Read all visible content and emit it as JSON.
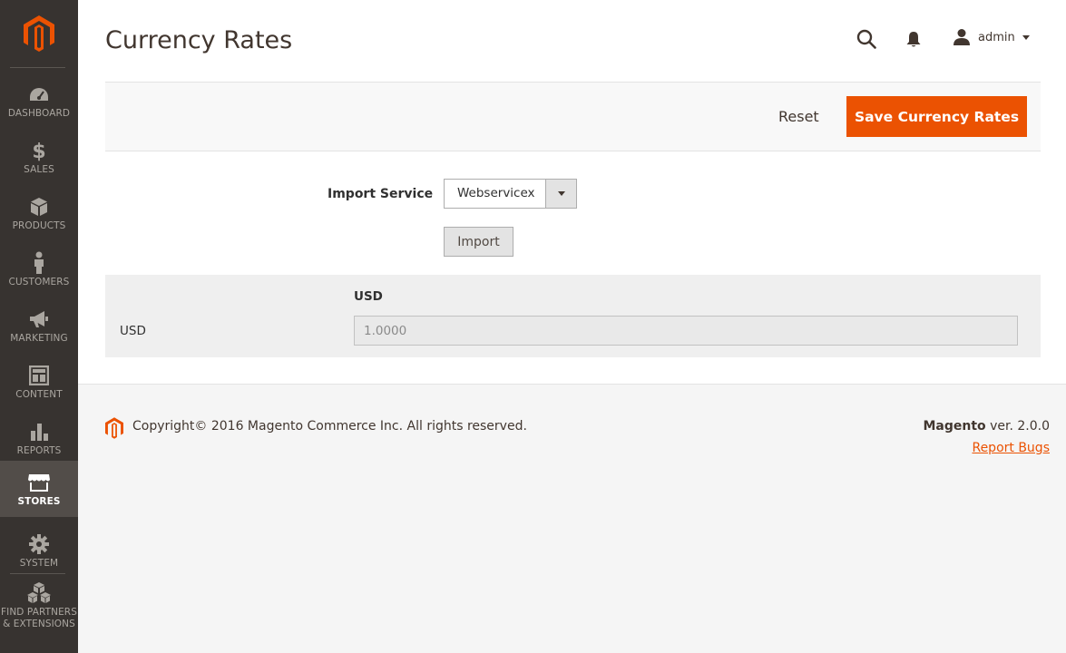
{
  "sidebar": {
    "items": [
      {
        "label": "DASHBOARD",
        "icon": "dashboard-icon"
      },
      {
        "label": "SALES",
        "icon": "dollar-icon"
      },
      {
        "label": "PRODUCTS",
        "icon": "box-icon"
      },
      {
        "label": "CUSTOMERS",
        "icon": "person-icon"
      },
      {
        "label": "MARKETING",
        "icon": "megaphone-icon"
      },
      {
        "label": "CONTENT",
        "icon": "layout-icon"
      },
      {
        "label": "REPORTS",
        "icon": "bar-chart-icon"
      },
      {
        "label": "STORES",
        "icon": "store-icon",
        "active": true
      },
      {
        "label": "SYSTEM",
        "icon": "gear-icon"
      },
      {
        "label": "FIND PARTNERS & EXTENSIONS",
        "icon": "cubes-icon"
      }
    ]
  },
  "header": {
    "title": "Currency Rates",
    "user": "admin"
  },
  "actions": {
    "reset_label": "Reset",
    "save_label": "Save Currency Rates"
  },
  "import": {
    "label": "Import Service",
    "selected": "Webservicex",
    "button_label": "Import"
  },
  "rates": {
    "column_header": "USD",
    "row_label": "USD",
    "value": "1.0000"
  },
  "footer": {
    "copyright": "Copyright© 2016 Magento Commerce Inc. All rights reserved.",
    "brand": "Magento",
    "version": " ver. 2.0.0",
    "report_bugs": "Report Bugs"
  },
  "colors": {
    "accent": "#eb5202",
    "sidebar_bg": "#373330",
    "sidebar_active": "#524d49"
  }
}
